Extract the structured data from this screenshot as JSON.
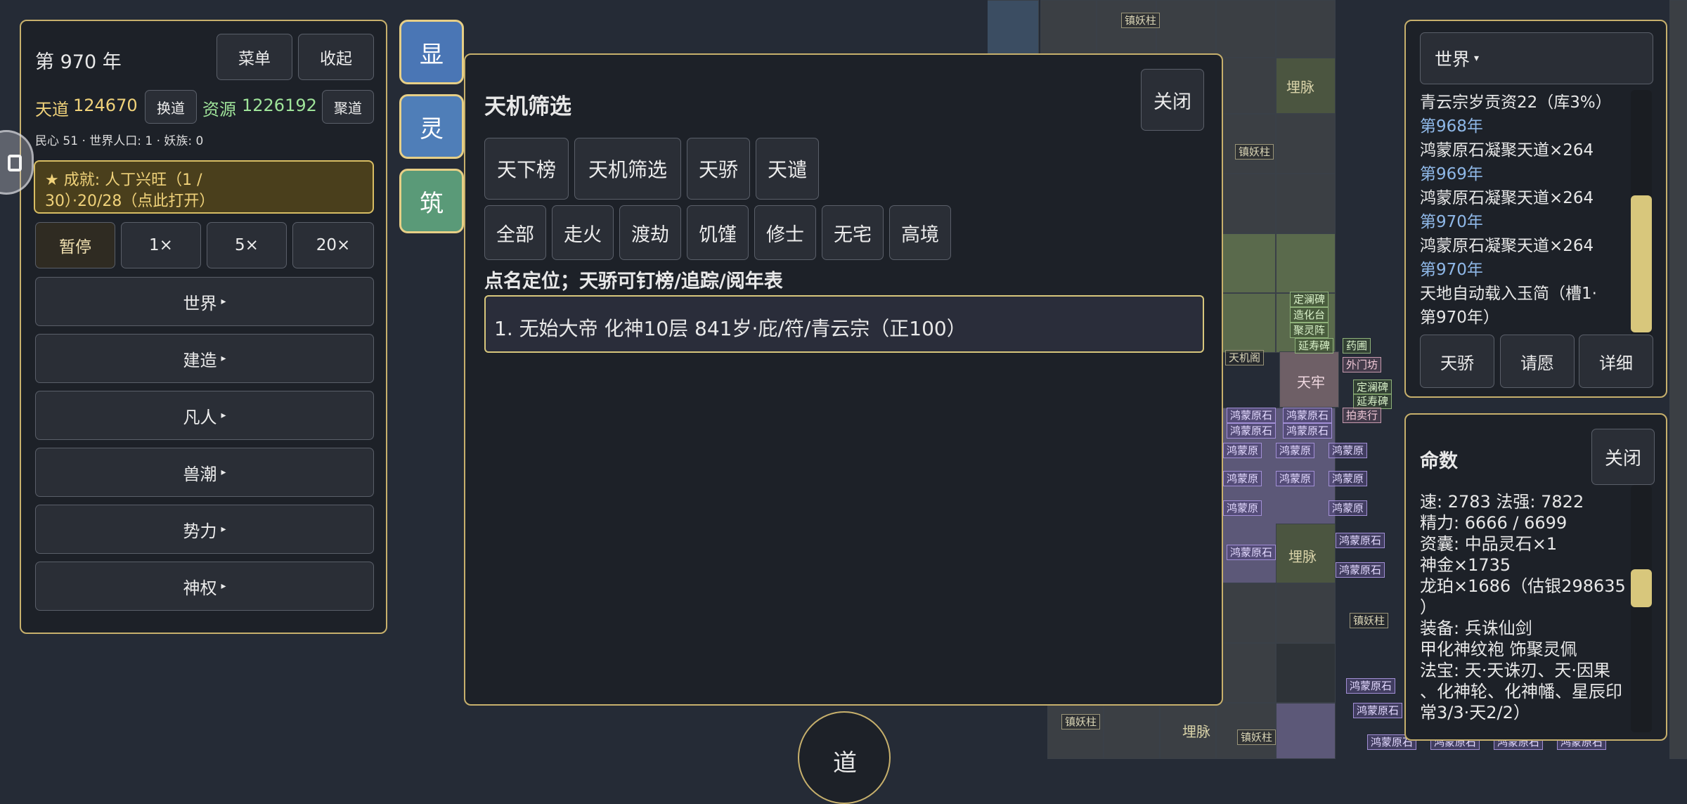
{
  "colors": {
    "panel_border": "#c7b06c",
    "gold": "#f0d27a",
    "green": "#9fe49a",
    "achievement_bg": "#4a3f1c",
    "tab_xian": "#4a76b5",
    "tab_ling": "#4f7eb8",
    "tab_zhu": "#5a9a78"
  },
  "left": {
    "year": "第 970 年",
    "menu_btn": "菜单",
    "collapse_btn": "收起",
    "tiandao_label": "天道",
    "tiandao_value": "124670",
    "swap_btn": "换道",
    "resource_label": "资源",
    "resource_value": "1226192",
    "gather_btn": "聚道",
    "stats": "民心 51 · 世界人口: 1 · 妖族: 0",
    "achievement_line1": "★ 成就: 人丁兴旺（1 /",
    "achievement_line2": "30）·20/28（点此打开）",
    "speed": [
      "暂停",
      "1×",
      "5×",
      "20×"
    ],
    "menus": [
      "世界",
      "建造",
      "凡人",
      "兽潮",
      "势力",
      "神权"
    ],
    "menu_arrow": "▸"
  },
  "sidetabs": [
    "显",
    "灵",
    "筑"
  ],
  "main": {
    "title": "天机筛选",
    "close_btn": "关闭",
    "tabs": [
      "天下榜",
      "天机筛选",
      "天骄",
      "天谴"
    ],
    "filters": [
      "全部",
      "走火",
      "渡劫",
      "饥馑",
      "修士",
      "无宅",
      "高境"
    ],
    "hint": "点名定位；天骄可钉榜/追踪/阅年表",
    "result": "1. 无始大帝  化神10层  841岁·庇/符/青云宗（正100）"
  },
  "bottom_circle": "道",
  "right_top": {
    "dropdown": "世界",
    "dropdown_arrow": "▾",
    "log": [
      {
        "text": "青云宗岁贡资22（库3%）",
        "kind": "event"
      },
      {
        "text": "第968年",
        "kind": "year"
      },
      {
        "text": "鸿蒙原石凝聚天道×264",
        "kind": "event"
      },
      {
        "text": "第969年",
        "kind": "year"
      },
      {
        "text": "鸿蒙原石凝聚天道×264",
        "kind": "event"
      },
      {
        "text": "第970年",
        "kind": "year"
      },
      {
        "text": "鸿蒙原石凝聚天道×264",
        "kind": "event"
      },
      {
        "text": "第970年",
        "kind": "year"
      },
      {
        "text": "天地自动载入玉简（槽1·",
        "kind": "event"
      },
      {
        "text": "第970年）",
        "kind": "event"
      }
    ],
    "buttons": [
      "天骄",
      "请愿",
      "详细"
    ],
    "scroll_position": 0.55
  },
  "right_bottom": {
    "title": "命数",
    "close_btn": "关闭",
    "lines": [
      "速: 2783   法强: 7822",
      "精力: 6666 / 6699",
      "资囊: 中品灵石×1",
      "神金×1735",
      "龙珀×1686（估银298635",
      "）",
      "装备: 兵诛仙剑",
      "甲化神纹袍   饰聚灵佩",
      "法宝: 天·天诛刃、天·因果",
      "、化神轮、化神幡、星辰印",
      "常3/3·天2/2）"
    ],
    "scroll_position": 0.35
  },
  "map_labels": {
    "zhenyaozhu": "镇妖柱",
    "maimai": "埋脉",
    "dingxinbei": "定澜碑",
    "zaohuatai": "造化台",
    "julingzhen": "聚灵阵",
    "yanshoubei": "延寿碑",
    "yaopu": "药圃",
    "tianjige": "天机阁",
    "tianlao": "天牢",
    "waimenfang": "外门坊",
    "paimaihang": "拍卖行",
    "hongmengyuanshi": "鸿蒙原石",
    "hongmengyuan": "鸿蒙原"
  }
}
